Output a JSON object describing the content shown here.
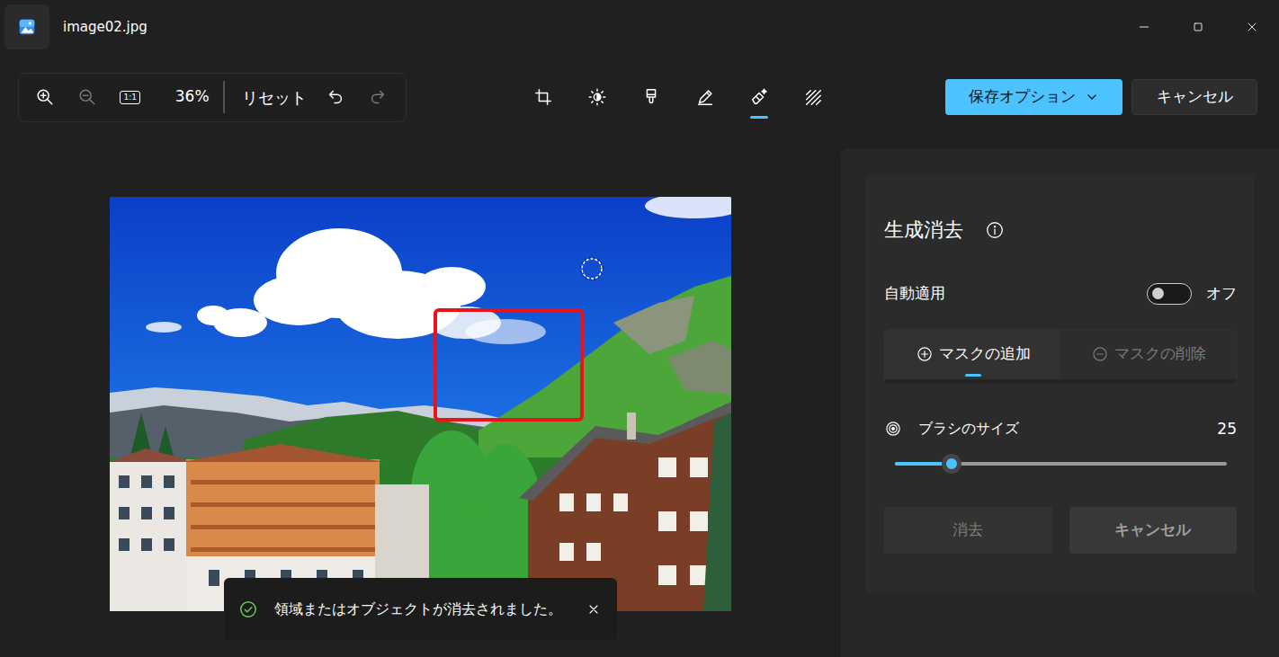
{
  "window": {
    "title": "image02.jpg"
  },
  "toolbar": {
    "zoom_in": {
      "disabled": false
    },
    "zoom_out": {
      "disabled": true
    },
    "actual_size": "1:1",
    "zoom": "36%",
    "reset": "リセット",
    "undo": {
      "disabled": false
    },
    "redo": {
      "disabled": true
    },
    "tools": [
      {
        "kind": "crop",
        "selected": false
      },
      {
        "kind": "adjust",
        "selected": false
      },
      {
        "kind": "filter",
        "selected": false
      },
      {
        "kind": "markup",
        "selected": false
      },
      {
        "kind": "erase",
        "selected": true
      },
      {
        "kind": "background",
        "selected": false
      }
    ],
    "save": "保存オプション",
    "cancel": "キャンセル"
  },
  "panel": {
    "title": "生成消去",
    "auto_apply": {
      "label": "自動適用",
      "on": false,
      "state_text": "オフ"
    },
    "mask_tabs": [
      {
        "label": "マスクの追加",
        "selected": true,
        "disabled": false
      },
      {
        "label": "マスクの削除",
        "selected": false,
        "disabled": true
      }
    ],
    "brush": {
      "label": "ブラシのサイズ",
      "value": "25",
      "level": 0.17
    },
    "buttons": [
      {
        "label": "消去",
        "disabled": true
      },
      {
        "label": "キャンセル",
        "disabled": true
      }
    ]
  },
  "toast": {
    "message": "領域またはオブジェクトが消去されました。"
  }
}
